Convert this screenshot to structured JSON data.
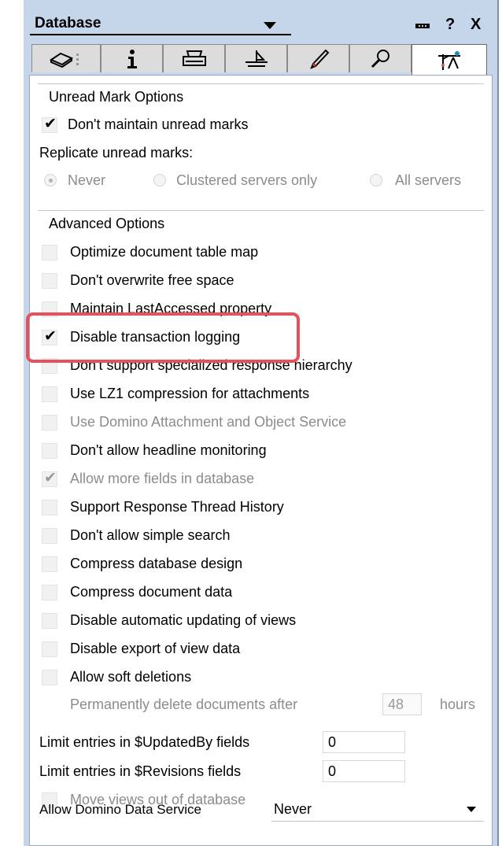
{
  "window": {
    "title": "Database",
    "help_label": "?",
    "close_label": "X"
  },
  "tabs": [
    {
      "icon": "properties-icon"
    },
    {
      "icon": "info-icon"
    },
    {
      "icon": "print-icon"
    },
    {
      "icon": "design-icon"
    },
    {
      "icon": "launch-icon"
    },
    {
      "icon": "search-icon"
    },
    {
      "icon": "advanced-icon",
      "active": true
    }
  ],
  "unread": {
    "header": "Unread Mark Options",
    "dont_maintain_label": "Don't maintain unread marks",
    "dont_maintain_checked": true,
    "replicate_label": "Replicate unread marks:",
    "radio_options": [
      "Never",
      "Clustered servers only",
      "All servers"
    ],
    "radio_selected": "Never"
  },
  "advanced": {
    "header": "Advanced Options",
    "options": [
      {
        "label": "Optimize document table map",
        "checked": false,
        "disabled": false
      },
      {
        "label": "Don't overwrite free space",
        "checked": false,
        "disabled": false
      },
      {
        "label": "Maintain LastAccessed property",
        "checked": false,
        "disabled": false
      },
      {
        "label": "Disable transaction logging",
        "checked": true,
        "disabled": false
      },
      {
        "label": "Don't support specialized response hierarchy",
        "checked": false,
        "disabled": false
      },
      {
        "label": "Use LZ1 compression for attachments",
        "checked": false,
        "disabled": false
      },
      {
        "label": "Use Domino Attachment and Object Service",
        "checked": false,
        "disabled": true
      },
      {
        "label": "Don't allow headline monitoring",
        "checked": false,
        "disabled": false
      },
      {
        "label": "Allow more fields in database",
        "checked": true,
        "disabled": true
      },
      {
        "label": "Support Response Thread History",
        "checked": false,
        "disabled": false
      },
      {
        "label": "Don't allow simple search",
        "checked": false,
        "disabled": false
      },
      {
        "label": "Compress database design",
        "checked": false,
        "disabled": false
      },
      {
        "label": "Compress document data",
        "checked": false,
        "disabled": false
      },
      {
        "label": "Disable automatic updating of views",
        "checked": false,
        "disabled": false
      },
      {
        "label": "Disable export of view data",
        "checked": false,
        "disabled": false
      },
      {
        "label": "Allow soft deletions",
        "checked": false,
        "disabled": false
      }
    ],
    "soft_delete_label": "Permanently delete documents after",
    "soft_delete_value": "48",
    "soft_delete_unit": "hours",
    "updated_by_label": "Limit entries in $UpdatedBy fields",
    "updated_by_value": "0",
    "revisions_label": "Limit entries in $Revisions fields",
    "revisions_value": "0",
    "move_views_label": "Move views out of database",
    "move_views_checked": false,
    "dds_label": "Allow Domino Data Service",
    "dds_value": "Never"
  },
  "colors": {
    "highlight": "#e8505b",
    "panel": "#c6d6ea"
  }
}
